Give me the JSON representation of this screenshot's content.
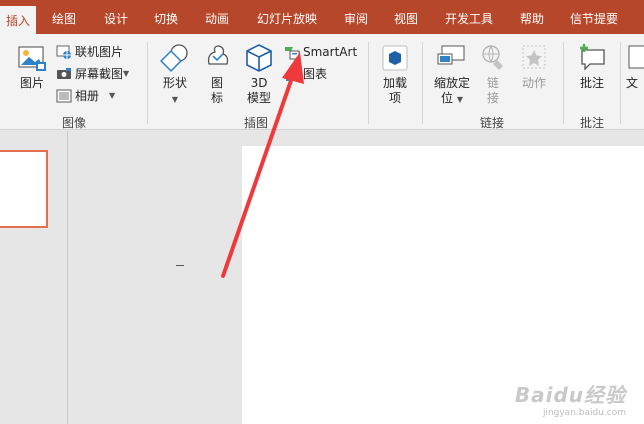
{
  "tabs": [
    "插入",
    "绘图",
    "设计",
    "切换",
    "动画",
    "幻灯片放映",
    "审阅",
    "视图",
    "开发工具",
    "帮助",
    "信节提要"
  ],
  "active_tab": "插入",
  "ribbon": {
    "image_group": {
      "label": "图像",
      "picture": "图片",
      "online_picture": "联机图片",
      "screenshot": "屏幕截图",
      "album": "相册"
    },
    "illustration_group": {
      "label": "插图",
      "shapes": "形状",
      "icons_line1": "图",
      "icons_line2": "标",
      "model_line1": "3D",
      "model_line2": "模型",
      "smartart": "SmartArt",
      "chart": "图表"
    },
    "addins": {
      "line1": "加载",
      "line2": "项"
    },
    "links_group": {
      "label": "链接",
      "zoom_line1": "缩放定",
      "zoom_line2": "位",
      "link_line1": "链",
      "link_line2": "接",
      "action": "动作"
    },
    "comments_group": {
      "label": "批注",
      "comment": "批注"
    },
    "text_group": {
      "partial": "文"
    }
  },
  "colors": {
    "accent": "#b7472a",
    "ribbon_bg": "#f3f3f3",
    "arrow": "#f0393b"
  },
  "watermark": {
    "brand": "Baidu经验",
    "url": "jingyan.baidu.com"
  }
}
